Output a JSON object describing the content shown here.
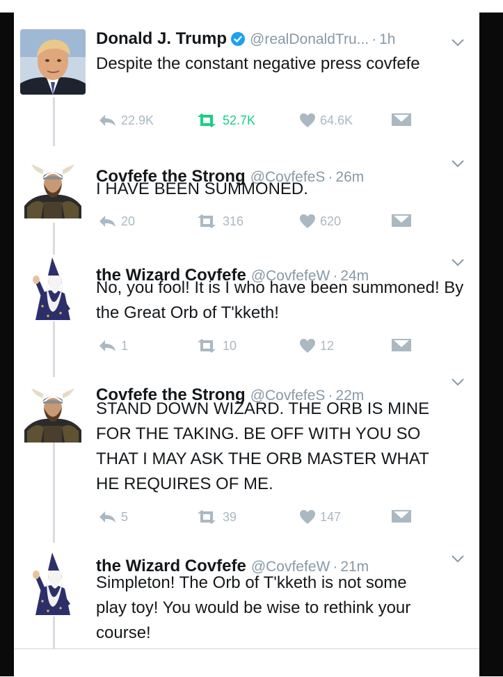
{
  "tweets": [
    {
      "display_name": "Donald J. Trump",
      "verified": true,
      "handle": "@realDonaldTru...",
      "time": "1h",
      "text": "Despite the constant negative press covfefe",
      "replies": "22.9K",
      "retweets": "52.7K",
      "likes": "64.6K",
      "retweeted": true,
      "avatar_icon": "portrait-photo"
    },
    {
      "display_name": "Covfefe the Strong",
      "handle": "@CovfefeS",
      "time": "26m",
      "text": "I HAVE BEEN SUMMONED.",
      "replies": "20",
      "retweets": "316",
      "likes": "620",
      "avatar_icon": "viking-icon"
    },
    {
      "display_name": "the Wizard Covfefe",
      "handle": "@CovfefeW",
      "time": "24m",
      "text": "No, you fool! It is I who have been summoned! By the Great Orb of T'kketh!",
      "replies": "1",
      "retweets": "10",
      "likes": "12",
      "avatar_icon": "wizard-icon"
    },
    {
      "display_name": "Covfefe the Strong",
      "handle": "@CovfefeS",
      "time": "22m",
      "text": "STAND DOWN WIZARD. THE ORB IS MINE FOR THE TAKING. BE OFF WITH YOU SO THAT I MAY ASK THE ORB MASTER WHAT HE REQUIRES OF ME.",
      "replies": "5",
      "retweets": "39",
      "likes": "147",
      "avatar_icon": "viking-icon"
    },
    {
      "display_name": "the Wizard Covfefe",
      "handle": "@CovfefeW",
      "time": "21m",
      "text": "Simpleton! The Orb of T'kketh is not some play toy! You would be wise to rethink your course!",
      "avatar_icon": "wizard-icon"
    }
  ],
  "separator": "·",
  "colors": {
    "text": "#14171a",
    "muted": "#8899a6",
    "icon": "#aab8c2",
    "retweet_active": "#19cf86",
    "verified": "#1da1f2",
    "thread_line": "#d6dce1"
  }
}
